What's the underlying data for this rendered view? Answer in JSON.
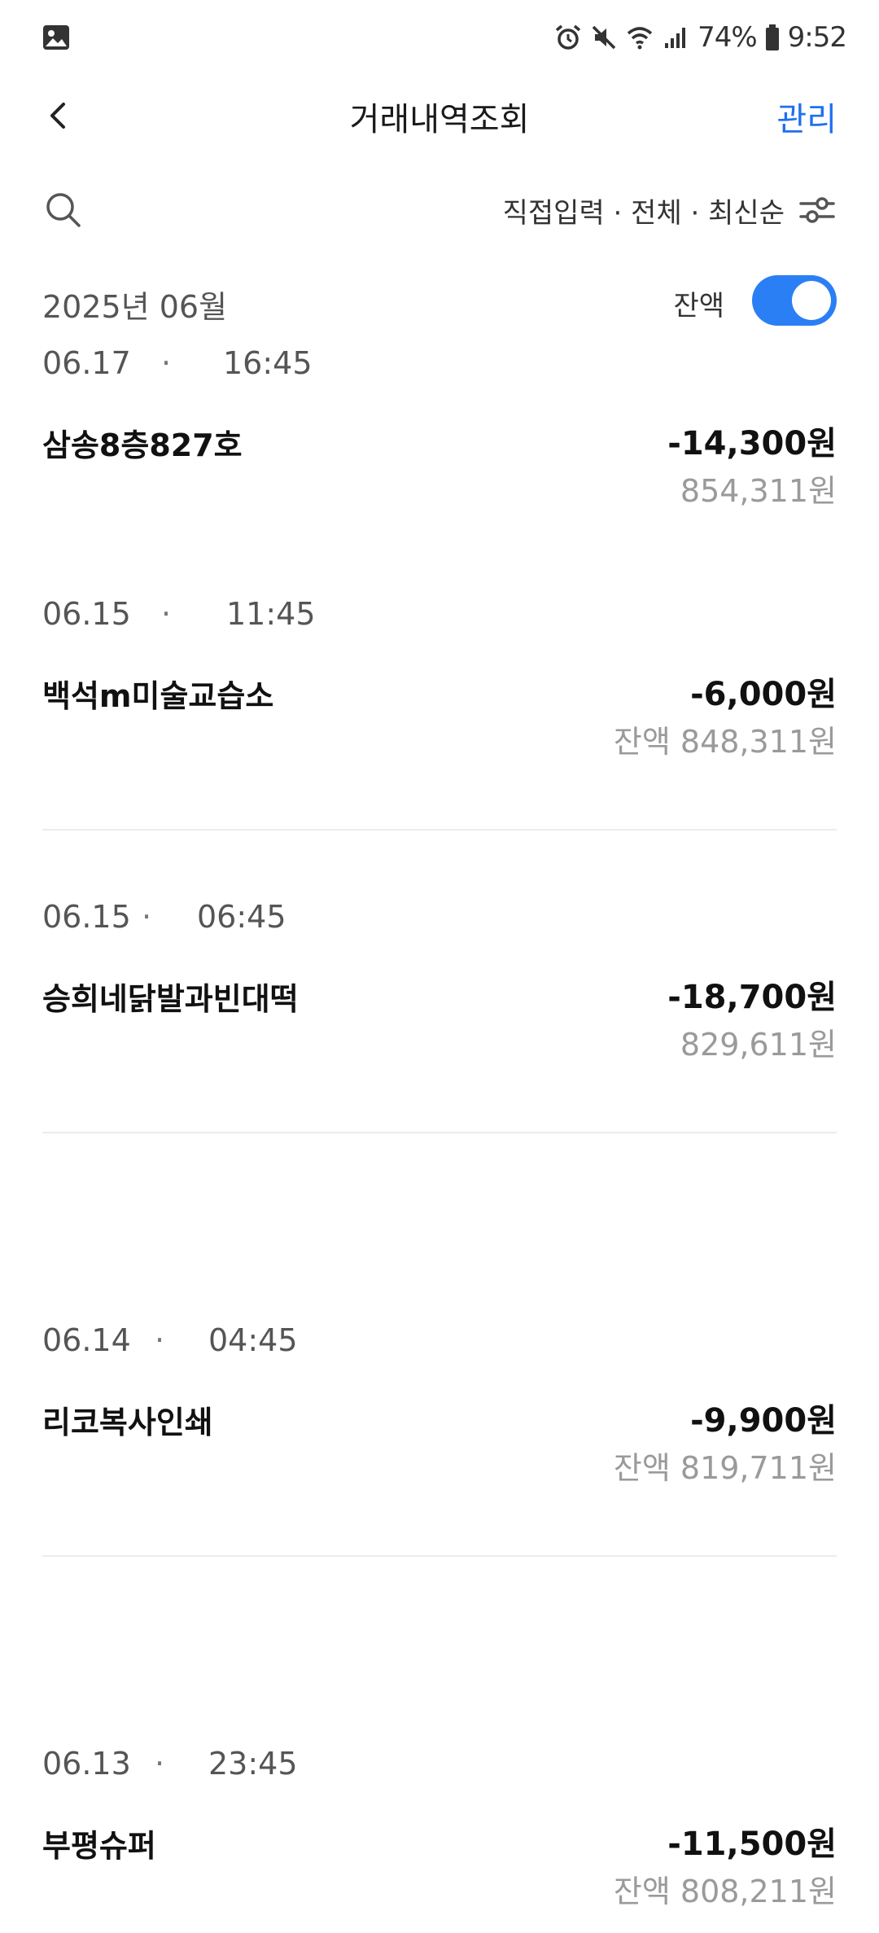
{
  "status_bar": {
    "battery": "74%",
    "time": "9:52",
    "icons": [
      "gallery-icon",
      "alarm-icon",
      "mute-icon",
      "wifi-icon",
      "signal-icon",
      "battery-icon"
    ]
  },
  "header": {
    "title": "거래내역조회",
    "manage_label": "관리",
    "back_icon": "chevron-left-icon"
  },
  "filter": {
    "text": "직접입력 · 전체 · 최신순",
    "search_icon": "search-icon",
    "filter_icon": "sliders-icon"
  },
  "month": {
    "label": "2025년 06월",
    "balance_label": "잔액",
    "balance_toggle_on": true
  },
  "colors": {
    "accent": "#2b7ff4",
    "link": "#1f6ff0",
    "muted": "#9a9a9a",
    "divider": "#ececec"
  },
  "transactions": [
    {
      "date": "06.17",
      "dot": "·",
      "time": "16:45",
      "name": "삼송8층827호",
      "amount": "-14,300원",
      "balance": "854,311원"
    },
    {
      "date": "06.15",
      "dot": "·",
      "time": "11:45",
      "name": "백석m미술교습소",
      "amount": "-6,000원",
      "balance": "잔액 848,311원"
    },
    {
      "date": "06.15",
      "dot": "·",
      "time": "06:45",
      "name": "승희네닭발과빈대떡",
      "amount": "-18,700원",
      "balance": "829,611원"
    },
    {
      "date": "06.14",
      "dot": "·",
      "time": "04:45",
      "name": "리코복사인쇄",
      "amount": "-9,900원",
      "balance": "잔액 819,711원"
    },
    {
      "date": "06.13",
      "dot": "·",
      "time": "23:45",
      "name": "부평슈퍼",
      "amount": "-11,500원",
      "balance": "잔액 808,211원"
    }
  ]
}
